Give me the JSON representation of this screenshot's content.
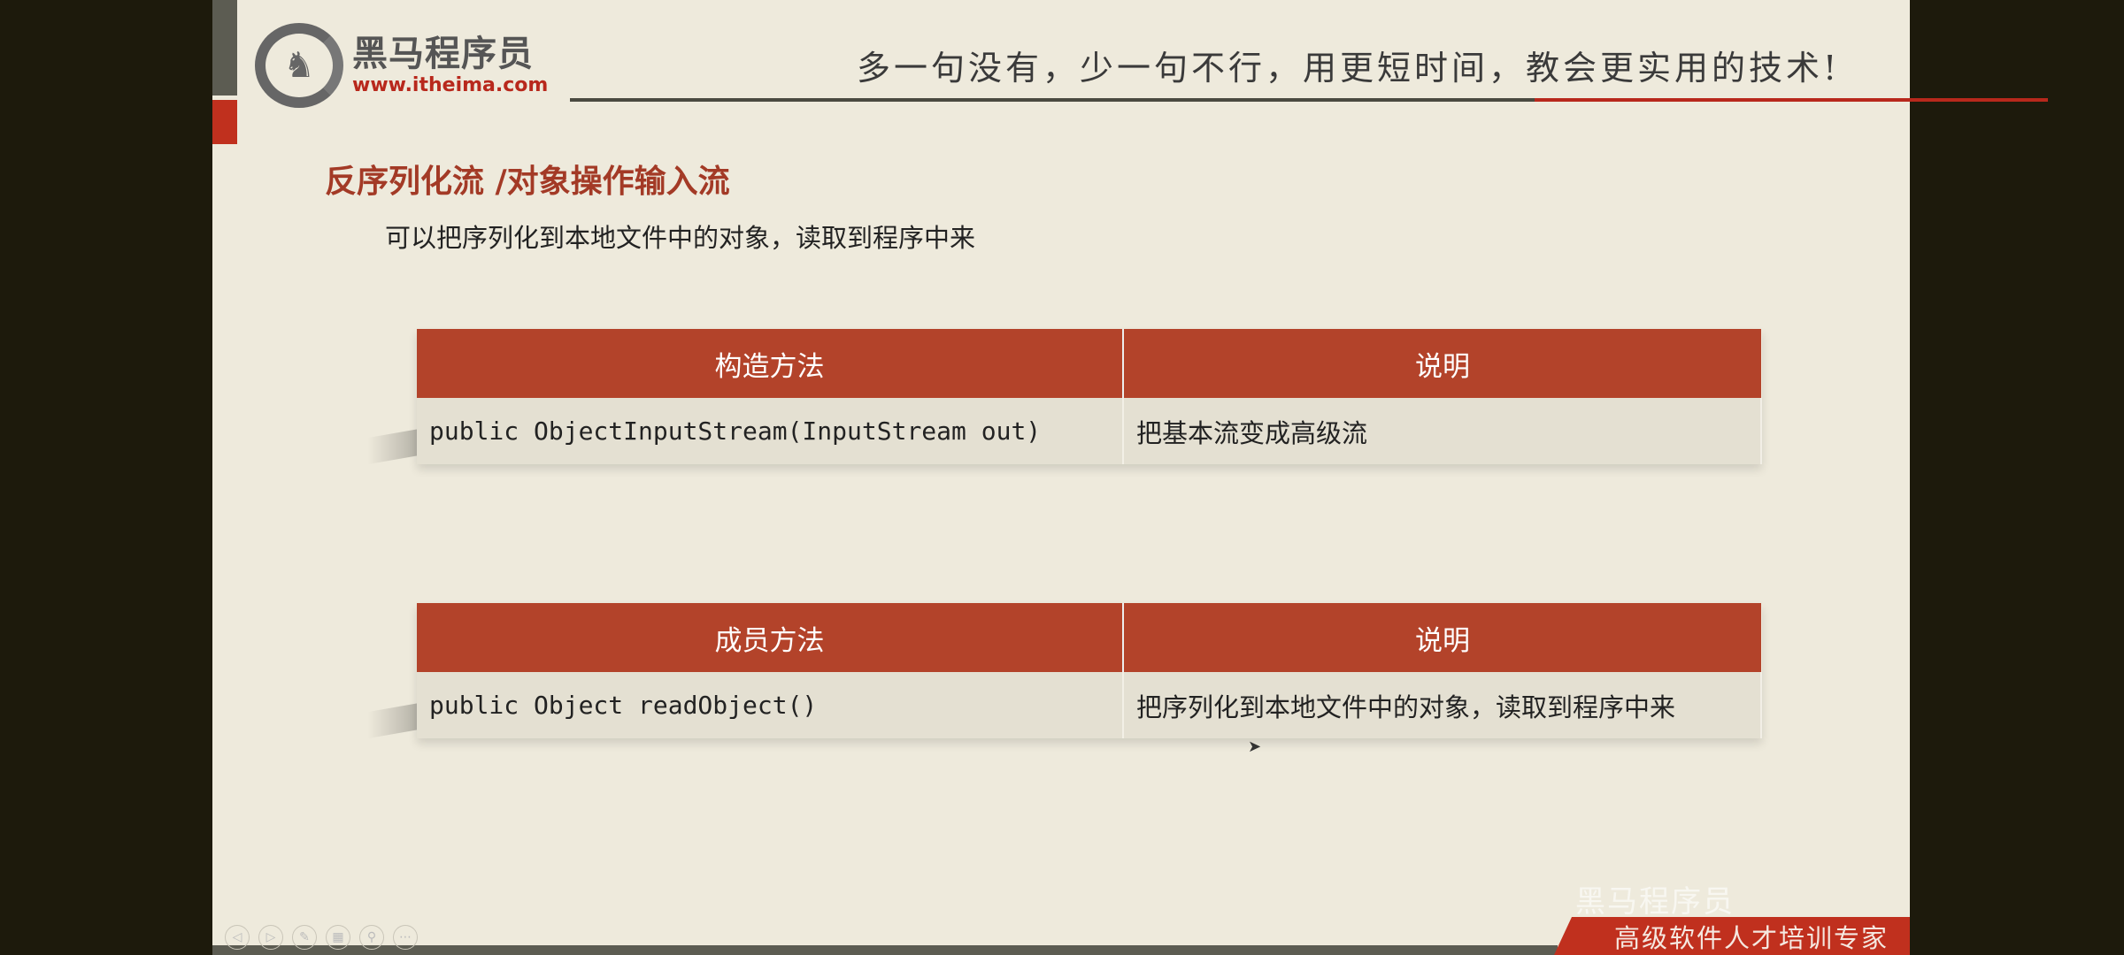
{
  "header": {
    "logo_cn": "黑马程序员",
    "logo_url": "www.itheima.com",
    "slogan": "多一句没有，少一句不行，用更短时间，教会更实用的技术!"
  },
  "main": {
    "title": "反序列化流 /对象操作输入流",
    "subtitle": "可以把序列化到本地文件中的对象，读取到程序中来",
    "constructor_table": {
      "headers": [
        "构造方法",
        "说明"
      ],
      "rows": [
        [
          "public ObjectInputStream(InputStream out)",
          "把基本流变成高级流"
        ]
      ]
    },
    "member_table": {
      "headers": [
        "成员方法",
        "说明"
      ],
      "rows": [
        [
          "public Object readObject()",
          "把序列化到本地文件中的对象，读取到程序中来"
        ]
      ]
    }
  },
  "footer": {
    "ribbon": "高级软件人才培训专家",
    "watermark": "黑马程序员"
  },
  "colors": {
    "accent": "#b3432a",
    "brand_red": "#c0301e"
  }
}
